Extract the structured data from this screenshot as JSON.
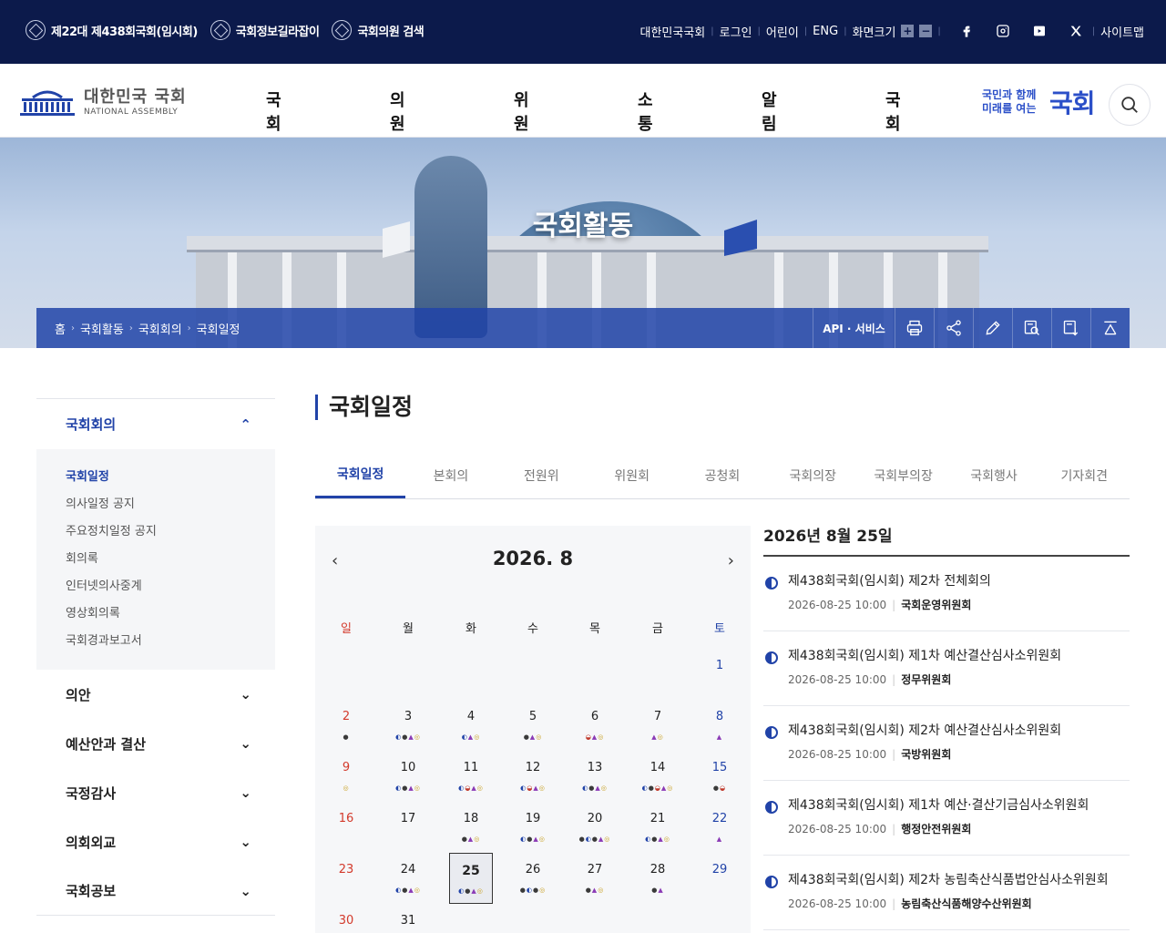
{
  "topbar": {
    "links": [
      "제22대 제438회국회(임시회)",
      "국회정보길라잡이",
      "국회의원 검색"
    ],
    "right_links": [
      "대한민국국회",
      "로그인",
      "어린이",
      "ENG"
    ],
    "font_size_label": "화면크기",
    "zoom_in": "+",
    "zoom_out": "−",
    "sitemap": "사이트맵"
  },
  "header": {
    "logo_ko": "대한민국 국회",
    "logo_en": "NATIONAL ASSEMBLY",
    "gnb": [
      "국회활동",
      "의원활동",
      "위원회",
      "소통마당",
      "알림마당",
      "국회소개"
    ],
    "slogan_small": "국민과 함께 미래를 여는",
    "slogan_big": "국회"
  },
  "banner": {
    "title": "국회활동",
    "breadcrumb": [
      "홈",
      "국회활동",
      "국회회의",
      "국회일정"
    ],
    "api_label": "API · 서비스"
  },
  "sidebar": {
    "active_section": "국회회의",
    "sub_items": [
      "국회일정",
      "의사일정 공지",
      "주요정치일정 공지",
      "회의록",
      "인터넷의사중계",
      "영상회의록",
      "국회경과보고서"
    ],
    "sections": [
      "의안",
      "예산안과 결산",
      "국정감사",
      "의회외교",
      "국회공보"
    ]
  },
  "content": {
    "page_title": "국회일정",
    "tabs": [
      "국회일정",
      "본회의",
      "전원위",
      "위원회",
      "공청회",
      "국회의장",
      "국회부의장",
      "국회행사",
      "기자회견"
    ]
  },
  "calendar": {
    "title": "2026. 8",
    "prev": "‹",
    "next": "›",
    "weekdays": [
      "일",
      "월",
      "화",
      "수",
      "목",
      "금",
      "토"
    ],
    "today": 25,
    "weeks": [
      [
        null,
        null,
        null,
        null,
        null,
        null,
        {
          "d": 1,
          "dots": ""
        }
      ],
      [
        {
          "d": 2,
          "dots": "●"
        },
        {
          "d": 3,
          "dots": "◐●▲◎"
        },
        {
          "d": 4,
          "dots": "◐▲◎"
        },
        {
          "d": 5,
          "dots": "●▲◎"
        },
        {
          "d": 6,
          "dots": "◒▲◎"
        },
        {
          "d": 7,
          "dots": "▲◎"
        },
        {
          "d": 8,
          "dots": "▲"
        }
      ],
      [
        {
          "d": 9,
          "dots": "◎"
        },
        {
          "d": 10,
          "dots": "◐●▲◎"
        },
        {
          "d": 11,
          "dots": "◐◒▲◎"
        },
        {
          "d": 12,
          "dots": "◐◒▲◎"
        },
        {
          "d": 13,
          "dots": "◐●▲◎"
        },
        {
          "d": 14,
          "dots": "◐●◒▲◎"
        },
        {
          "d": 15,
          "dots": "●◒"
        }
      ],
      [
        {
          "d": 16,
          "dots": ""
        },
        {
          "d": 17,
          "dots": ""
        },
        {
          "d": 18,
          "dots": "●▲◎"
        },
        {
          "d": 19,
          "dots": "◐●▲◎"
        },
        {
          "d": 20,
          "dots": "●◐●▲◎"
        },
        {
          "d": 21,
          "dots": "◐●▲◎"
        },
        {
          "d": 22,
          "dots": "▲"
        }
      ],
      [
        {
          "d": 23,
          "dots": ""
        },
        {
          "d": 24,
          "dots": "◐●▲◎"
        },
        {
          "d": 25,
          "dots": "◐●▲◎"
        },
        {
          "d": 26,
          "dots": "●◐●◎"
        },
        {
          "d": 27,
          "dots": "●▲◎"
        },
        {
          "d": 28,
          "dots": "●▲"
        },
        {
          "d": 29,
          "dots": ""
        }
      ],
      [
        {
          "d": 30,
          "dots": ""
        },
        {
          "d": 31,
          "dots": ""
        },
        null,
        null,
        null,
        null,
        null
      ]
    ]
  },
  "schedule": {
    "date": "2026년 8월 25일",
    "items": [
      {
        "title": "제438회국회(임시회) 제2차 전체회의",
        "time": "2026-08-25 10:00",
        "committee": "국회운영위원회"
      },
      {
        "title": "제438회국회(임시회) 제1차 예산결산심사소위원회",
        "time": "2026-08-25 10:00",
        "committee": "정무위원회"
      },
      {
        "title": "제438회국회(임시회) 제2차 예산결산심사소위원회",
        "time": "2026-08-25 10:00",
        "committee": "국방위원회"
      },
      {
        "title": "제438회국회(임시회) 제1차 예산·결산기금심사소위원회",
        "time": "2026-08-25 10:00",
        "committee": "행정안전위원회"
      },
      {
        "title": "제438회국회(임시회) 제2차 농림축산식품법안심사소위원회",
        "time": "2026-08-25 10:00",
        "committee": "농림축산식품해양수산위원회"
      }
    ]
  },
  "colors": {
    "navy": "#0c1a4b",
    "accent": "#2143a8",
    "sunday": "#d33a2c"
  }
}
